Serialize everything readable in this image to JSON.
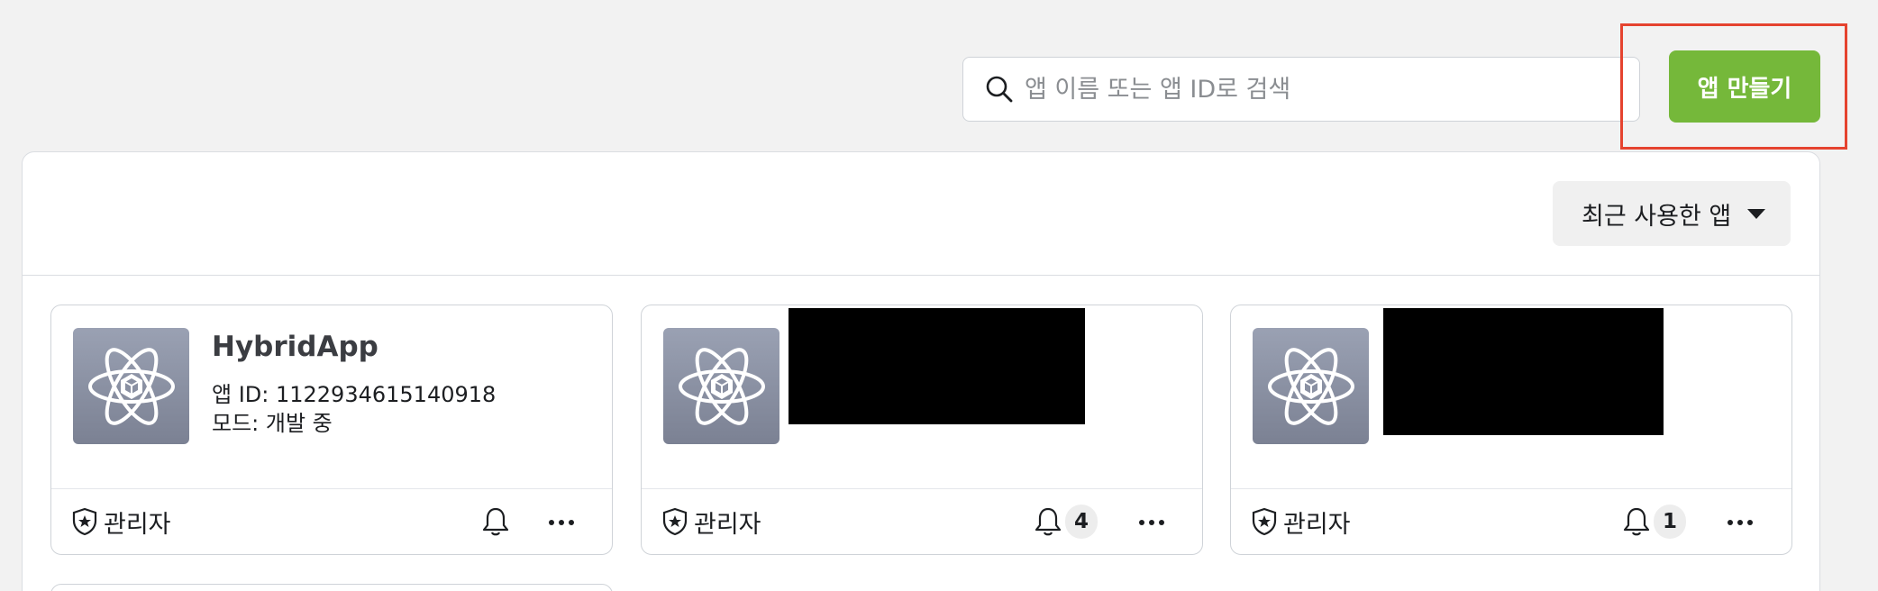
{
  "search": {
    "placeholder": "앱 이름 또는 앱 ID로 검색",
    "icon": "search-icon"
  },
  "create_button": {
    "label": "앱 만들기",
    "color": "#75b83a"
  },
  "highlight_color": "#e5432f",
  "sort": {
    "label": "최근 사용한 앱",
    "icon": "caret-down-icon"
  },
  "apps": [
    {
      "name": "HybridApp",
      "app_id_line": "앱 ID: 1122934615140918",
      "mode_line": "모드: 개발 중",
      "role": "관리자",
      "notifications": null,
      "redacted": false
    },
    {
      "name": "",
      "role": "관리자",
      "notifications": "4",
      "redacted": true
    },
    {
      "name": "",
      "role": "관리자",
      "notifications": "1",
      "redacted": true
    }
  ]
}
